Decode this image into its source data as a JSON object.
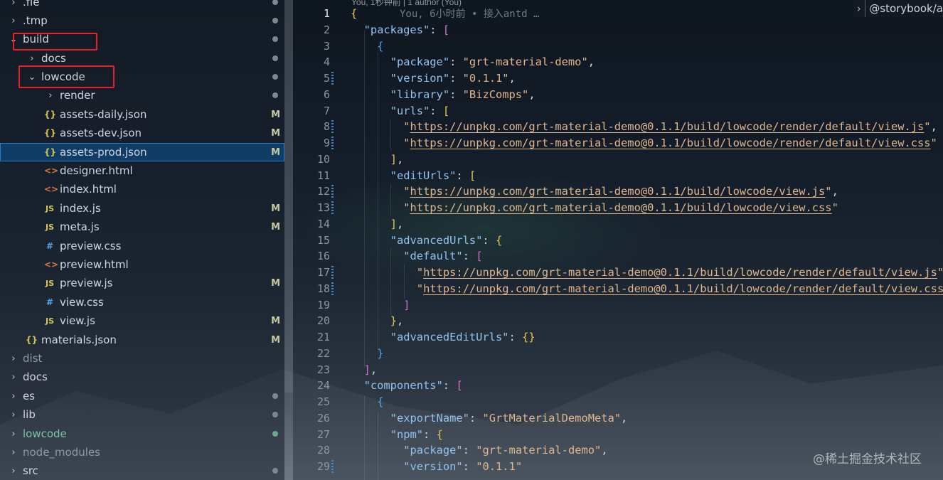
{
  "explorer": {
    "items": [
      {
        "label": ".fle",
        "twisty": "›",
        "status": "dot"
      },
      {
        "label": ".tmp",
        "twisty": "›",
        "status": "dot"
      },
      {
        "label": "build",
        "twisty": "⌄",
        "status": "dot"
      },
      {
        "label": "docs",
        "twisty": "›",
        "status": "dot"
      },
      {
        "label": "lowcode",
        "twisty": "⌄",
        "status": "dot"
      },
      {
        "label": "render",
        "twisty": "›",
        "status": "dot"
      },
      {
        "label": "assets-daily.json",
        "icon": "{}",
        "status": "M"
      },
      {
        "label": "assets-dev.json",
        "icon": "{}",
        "status": "M"
      },
      {
        "label": "assets-prod.json",
        "icon": "{}",
        "status": "M"
      },
      {
        "label": "designer.html",
        "icon": "<>"
      },
      {
        "label": "index.html",
        "icon": "<>"
      },
      {
        "label": "index.js",
        "icon": "JS",
        "status": "M"
      },
      {
        "label": "meta.js",
        "icon": "JS",
        "status": "M"
      },
      {
        "label": "preview.css",
        "icon": "#"
      },
      {
        "label": "preview.html",
        "icon": "<>"
      },
      {
        "label": "preview.js",
        "icon": "JS",
        "status": "M"
      },
      {
        "label": "view.css",
        "icon": "#"
      },
      {
        "label": "view.js",
        "icon": "JS",
        "status": "M"
      },
      {
        "label": "materials.json",
        "icon": "{}",
        "status": "M"
      },
      {
        "label": "dist",
        "twisty": "›"
      },
      {
        "label": "docs",
        "twisty": "›"
      },
      {
        "label": "es",
        "twisty": "›",
        "status": "dot"
      },
      {
        "label": "lib",
        "twisty": "›",
        "status": "dot"
      },
      {
        "label": "lowcode",
        "twisty": "›",
        "status": "dot"
      },
      {
        "label": "node_modules",
        "twisty": "›"
      },
      {
        "label": "src",
        "twisty": "›",
        "status": "dot"
      }
    ]
  },
  "editor": {
    "codelens": "You, 1秒钟前 | 1 author (You)",
    "blame": "You, 6小时前 • 接入antd …",
    "breadcrumb": "@storybook/a",
    "line_numbers": [
      "1",
      "2",
      "3",
      "4",
      "5",
      "6",
      "7",
      "8",
      "9",
      "10",
      "11",
      "12",
      "13",
      "14",
      "15",
      "16",
      "17",
      "18",
      "19",
      "20",
      "21",
      "22",
      "23",
      "24",
      "25",
      "26",
      "27",
      "28",
      "29"
    ],
    "lines": [
      "{",
      "  \"packages\": [",
      "    {",
      "      \"package\": \"grt-material-demo\",",
      "      \"version\": \"0.1.1\",",
      "      \"library\": \"BizComps\",",
      "      \"urls\": [",
      "        \"https://unpkg.com/grt-material-demo@0.1.1/build/lowcode/render/default/view.js\",",
      "        \"https://unpkg.com/grt-material-demo@0.1.1/build/lowcode/render/default/view.css\"",
      "      ],",
      "      \"editUrls\": [",
      "        \"https://unpkg.com/grt-material-demo@0.1.1/build/lowcode/view.js\",",
      "        \"https://unpkg.com/grt-material-demo@0.1.1/build/lowcode/view.css\"",
      "      ],",
      "      \"advancedUrls\": {",
      "        \"default\": [",
      "          \"https://unpkg.com/grt-material-demo@0.1.1/build/lowcode/render/default/view.js\"",
      "          \"https://unpkg.com/grt-material-demo@0.1.1/build/lowcode/render/default/view.css",
      "        ]",
      "      },",
      "      \"advancedEditUrls\": {}",
      "    }",
      "  ],",
      "  \"components\": [",
      "    {",
      "      \"exportName\": \"GrtMaterialDemoMeta\",",
      "      \"npm\": {",
      "        \"package\": \"grt-material-demo\",",
      "        \"version\": \"0.1.1\""
    ]
  },
  "watermark": "@稀土掘金技术社区"
}
